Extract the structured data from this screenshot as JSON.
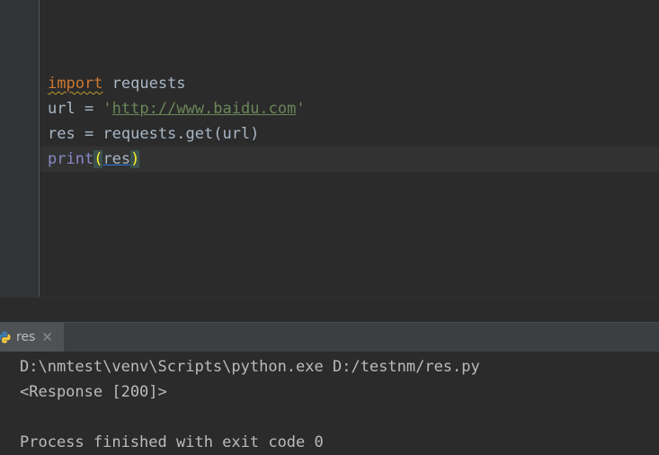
{
  "editor": {
    "lines": [
      {
        "kw": "import",
        "rest": " requests"
      },
      {
        "pre": "url = ",
        "quote_open": "'",
        "url": "http://www.baidu.com",
        "quote_close": "'"
      },
      {
        "text": "res = requests.get(url)"
      },
      {
        "builtin": "print",
        "paren_open": "(",
        "arg": "res",
        "paren_close": ")"
      }
    ]
  },
  "run_panel": {
    "tab_label": "res",
    "close_glyph": "✕"
  },
  "console": {
    "lines": [
      "D:\\nmtest\\venv\\Scripts\\python.exe D:/testnm/res.py",
      "<Response [200]>",
      "",
      "Process finished with exit code 0"
    ]
  },
  "colors": {
    "keyword": "#cc7832",
    "string": "#6a8759",
    "builtin": "#8888c6",
    "text": "#a9b7c6",
    "paren_highlight": "#ffef28"
  }
}
